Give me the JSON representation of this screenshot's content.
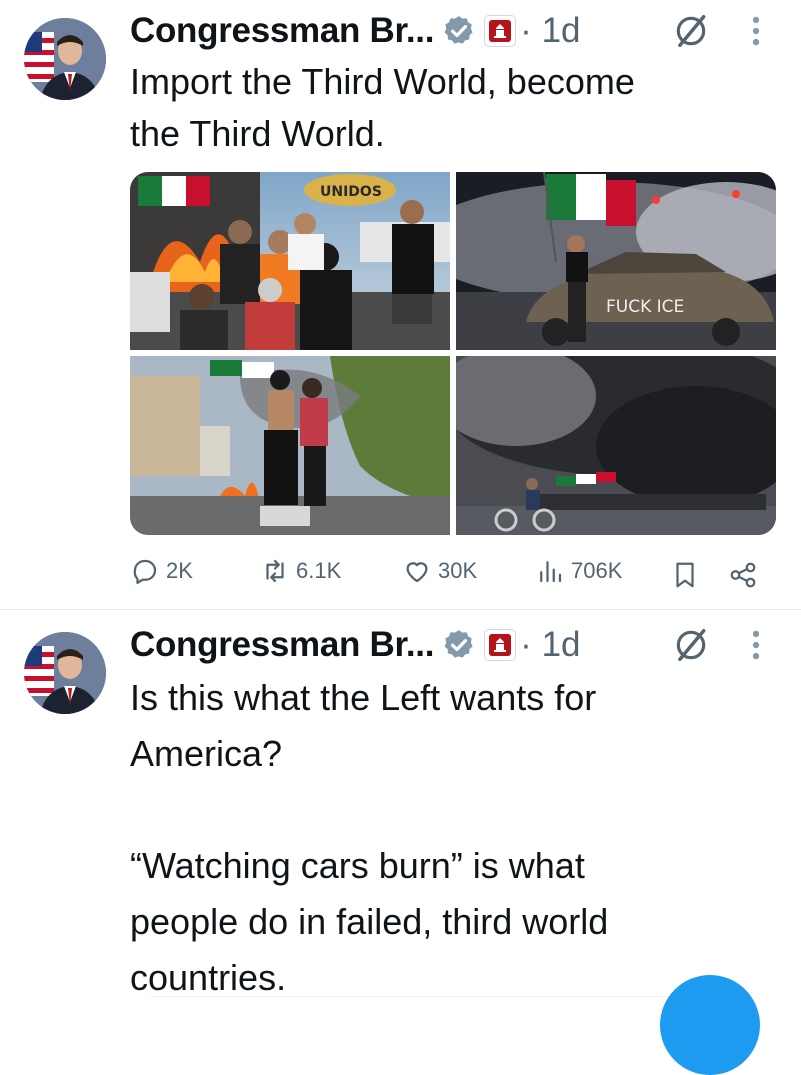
{
  "tweets": [
    {
      "author": "Congressman Br...",
      "time": "1d",
      "separator": "·",
      "text": "Import the Third World, become\nthe Third World.",
      "images": [
        {
          "overlay_text": "UNIDOS"
        },
        {
          "overlay_text": "FUCK ICE"
        },
        {
          "overlay_text": ""
        },
        {
          "overlay_text": ""
        }
      ],
      "actions": {
        "replies": "2K",
        "reposts": "6.1K",
        "likes": "30K",
        "views": "706K"
      }
    },
    {
      "author": "Congressman Br...",
      "time": "1d",
      "separator": "·",
      "text": "Is this what the Left wants for\nAmerica?\n\n“Watching cars burn” is what\npeople do in failed, third world\ncountries."
    }
  ],
  "icons": {
    "verified": "verified-badge-icon",
    "affiliation": "congress-affiliation-icon",
    "grok": "grok-icon",
    "more": "more-dots-icon",
    "reply": "reply-icon",
    "repost": "repost-icon",
    "like": "like-icon",
    "views": "views-icon",
    "bookmark": "bookmark-icon",
    "share": "share-icon"
  },
  "colors": {
    "text": "#0f1419",
    "secondary": "#536471",
    "accent": "#1d9bf0",
    "verified_gray": "#829aab",
    "affiliation_red": "#b5141b"
  }
}
